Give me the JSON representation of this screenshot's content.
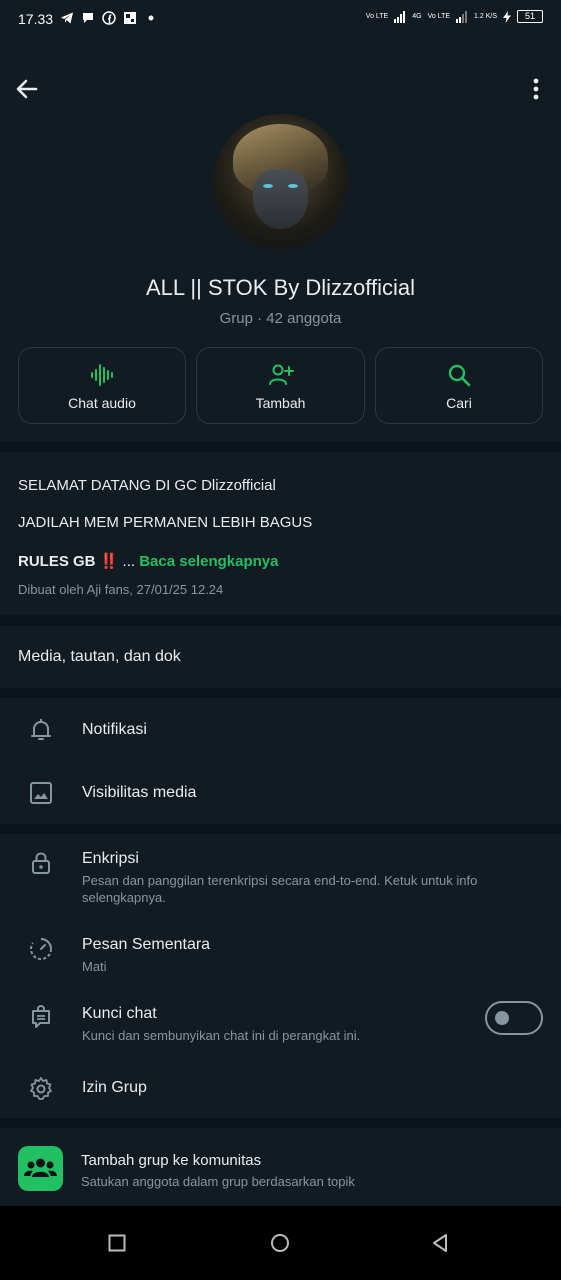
{
  "status_bar": {
    "time": "17.33",
    "battery": "51",
    "net1": "Vo LTE",
    "net2": "4G",
    "net3": "Vo LTE",
    "speed": "1.2 K/S",
    "icons": [
      "telegram-icon",
      "chat-icon",
      "facebook-icon",
      "news-icon",
      "dot-icon"
    ]
  },
  "header": {
    "group_name": "ALL || STOK By Dlizzofficial",
    "subtitle": "Grup · 42 anggota"
  },
  "actions": [
    {
      "label": "Chat audio",
      "icon": "audio-wave-icon"
    },
    {
      "label": "Tambah",
      "icon": "add-person-icon"
    },
    {
      "label": "Cari",
      "icon": "search-icon"
    }
  ],
  "description": {
    "line1": "SELAMAT DATANG DI GC Dlizzofficial",
    "line2": "JADILAH MEM PERMANEN LEBIH BAGUS",
    "rules_prefix": "RULES GB ",
    "rules_bang": "‼️",
    "ellipsis": " ... ",
    "read_more": "Baca selengkapnya",
    "created": "Dibuat oleh Aji fans, 27/01/25 12.24"
  },
  "media": {
    "label": "Media, tautan, dan dok"
  },
  "settings1": [
    {
      "title": "Notifikasi",
      "icon": "bell-icon"
    },
    {
      "title": "Visibilitas media",
      "icon": "image-icon"
    }
  ],
  "settings2": {
    "encryption": {
      "title": "Enkripsi",
      "subtitle": "Pesan dan panggilan terenkripsi secara end-to-end. Ketuk untuk info selengkapnya.",
      "icon": "lock-icon"
    },
    "disappearing": {
      "title": "Pesan Sementara",
      "subtitle": "Mati",
      "icon": "timer-icon"
    },
    "chat_lock": {
      "title": "Kunci chat",
      "subtitle": "Kunci dan sembunyikan chat ini di perangkat ini.",
      "icon": "chat-lock-icon",
      "enabled": false
    },
    "permissions": {
      "title": "Izin Grup",
      "icon": "gear-icon"
    }
  },
  "community": {
    "title": "Tambah grup ke komunitas",
    "subtitle": "Satukan anggota dalam grup berdasarkan topik",
    "icon": "community-icon"
  },
  "colors": {
    "accent": "#21c063",
    "background": "#0b141a",
    "surface": "#121b22",
    "secondary_text": "#8696a0"
  }
}
